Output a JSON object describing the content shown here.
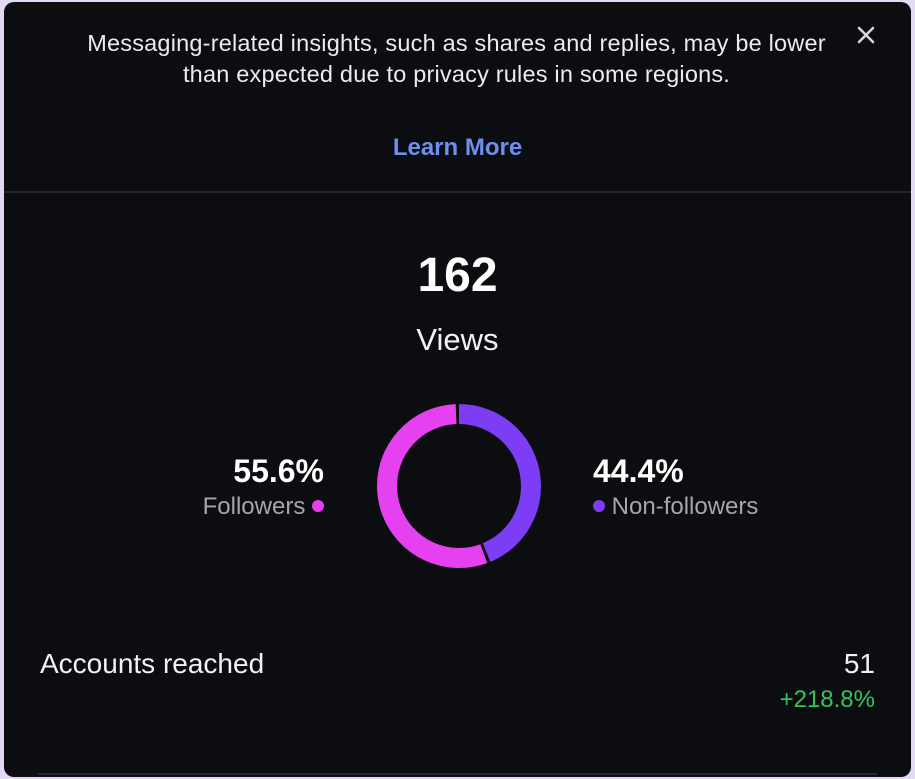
{
  "banner": {
    "message": "Messaging-related insights, such as shares and replies, may be lower than expected due to privacy rules in some regions.",
    "link_label": "Learn More",
    "close_icon": "close-icon"
  },
  "views": {
    "value": "162",
    "label": "Views"
  },
  "audience": {
    "followers": {
      "percent": "55.6%",
      "label": "Followers",
      "fraction": 0.556
    },
    "non_followers": {
      "percent": "44.4%",
      "label": "Non-followers",
      "fraction": 0.444
    }
  },
  "accounts_reached": {
    "label": "Accounts reached",
    "value": "51",
    "change": "+218.8%"
  },
  "colors": {
    "background": "#0c0d11",
    "followers": "#e541f0",
    "non_followers": "#7c3df4",
    "link": "#6c8ff0",
    "positive": "#34c45c"
  }
}
